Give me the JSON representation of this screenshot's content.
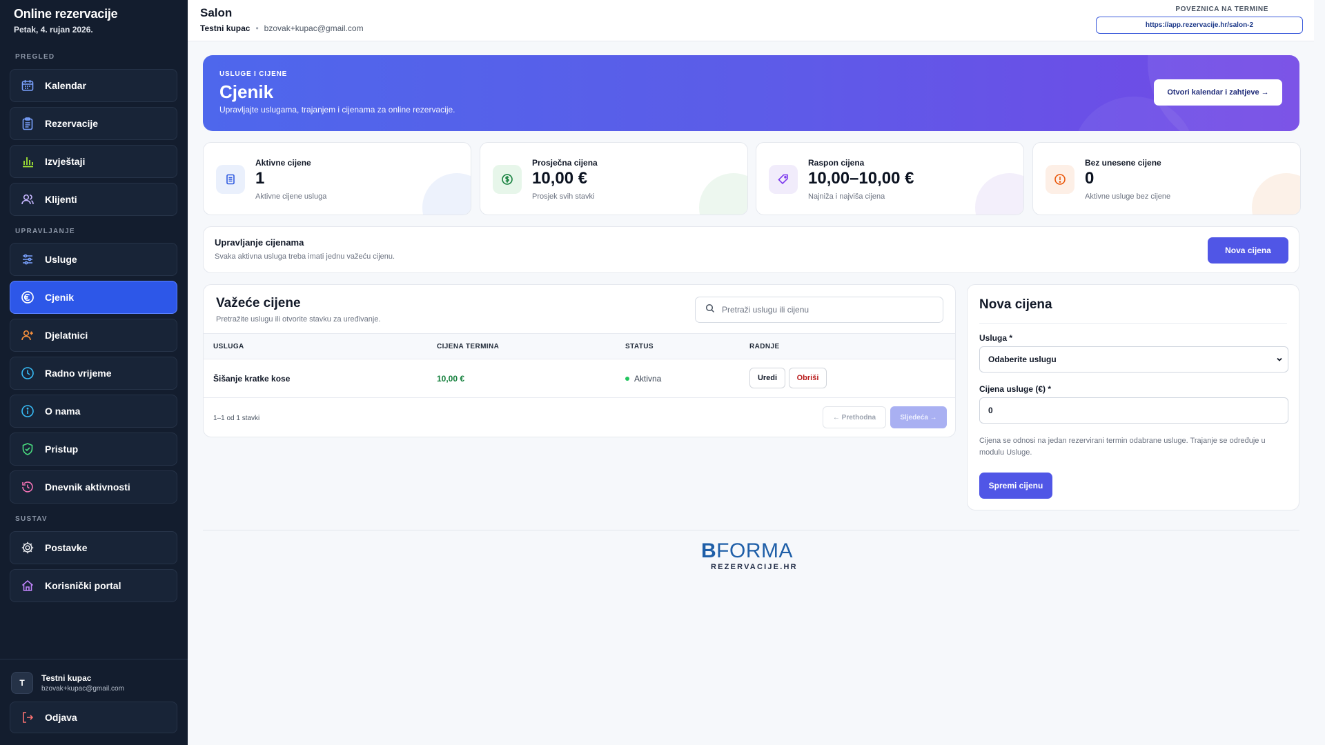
{
  "app": {
    "title": "Online rezervacije",
    "date": "Petak, 4. rujan 2026."
  },
  "sidebar": {
    "sections": {
      "pregled": "PREGLED",
      "upravljanje": "UPRAVLJANJE",
      "sustav": "SUSTAV"
    },
    "items": [
      {
        "label": "Kalendar",
        "icon": "calendar-icon"
      },
      {
        "label": "Rezervacije",
        "icon": "clipboard-icon"
      },
      {
        "label": "Izvještaji",
        "icon": "bar-chart-icon"
      },
      {
        "label": "Klijenti",
        "icon": "users-icon"
      },
      {
        "label": "Usluge",
        "icon": "sliders-icon"
      },
      {
        "label": "Cjenik",
        "icon": "euro-icon"
      },
      {
        "label": "Djelatnici",
        "icon": "user-plus-icon"
      },
      {
        "label": "Radno vrijeme",
        "icon": "clock-icon"
      },
      {
        "label": "O nama",
        "icon": "info-icon"
      },
      {
        "label": "Pristup",
        "icon": "shield-check-icon"
      },
      {
        "label": "Dnevnik aktivnosti",
        "icon": "history-icon"
      },
      {
        "label": "Postavke",
        "icon": "gear-icon"
      },
      {
        "label": "Korisnički portal",
        "icon": "home-icon"
      }
    ],
    "user": {
      "initial": "T",
      "name": "Testni kupac",
      "email": "bzovak+kupac@gmail.com"
    },
    "logout": "Odjava"
  },
  "header": {
    "title": "Salon",
    "customer": "Testni kupac",
    "email": "bzovak+kupac@gmail.com",
    "link_label": "POVEZNICA NA TERMINE",
    "link_url": "https://app.rezervacije.hr/salon-2"
  },
  "hero": {
    "kicker": "USLUGE I CIJENE",
    "title": "Cjenik",
    "description": "Upravljajte uslugama, trajanjem i cijenama za online rezervacije.",
    "button": "Otvori kalendar i zahtjeve →"
  },
  "stats": [
    {
      "label": "Aktivne cijene",
      "value": "1",
      "sub": "Aktivne cijene usluga"
    },
    {
      "label": "Prosječna cijena",
      "value": "10,00 €",
      "sub": "Prosjek svih stavki"
    },
    {
      "label": "Raspon cijena",
      "value": "10,00–10,00 €",
      "sub": "Najniža i najviša cijena"
    },
    {
      "label": "Bez unesene cijene",
      "value": "0",
      "sub": "Aktivne usluge bez cijene"
    }
  ],
  "management": {
    "title": "Upravljanje cijenama",
    "subtitle": "Svaka aktivna usluga treba imati jednu važeću cijenu.",
    "button": "Nova cijena"
  },
  "prices": {
    "title": "Važeće cijene",
    "subtitle": "Pretražite uslugu ili otvorite stavku za uređivanje.",
    "search_placeholder": "Pretraži uslugu ili cijenu",
    "columns": [
      "USLUGA",
      "CIJENA TERMINA",
      "STATUS",
      "RADNJE"
    ],
    "rows": [
      {
        "service": "Šišanje kratke kose",
        "price": "10,00 €",
        "status": "Aktivna",
        "edit": "Uredi",
        "delete": "Obriši"
      }
    ],
    "pagination_info": "1–1 od 1 stavki",
    "prev": "← Prethodna",
    "next": "Sljedeća →"
  },
  "form": {
    "title": "Nova cijena",
    "service_label": "Usluga *",
    "service_value": "Odaberite uslugu",
    "price_label": "Cijena usluge (€) *",
    "price_value": "0",
    "help": "Cijena se odnosi na jedan rezervirani termin odabrane usluge. Trajanje se određuje u modulu Usluge.",
    "submit": "Spremi cijenu"
  },
  "footer": {
    "logo_b": "B",
    "logo_rest": "FORMA",
    "logo_sub": "REZERVACIJE.HR"
  },
  "colors": {
    "accent": "#5056e6",
    "sidebar": "#131d2e",
    "active_nav": "#2d57e8",
    "price_green": "#15803d",
    "danger": "#b91c1c"
  }
}
